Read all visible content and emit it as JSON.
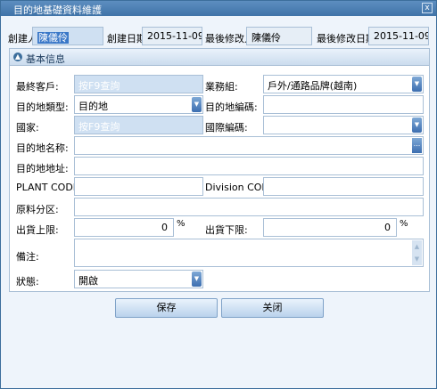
{
  "window": {
    "title": "目的地基礎資料維護",
    "close_glyph": "x"
  },
  "header": {
    "creator_label": "創建人:",
    "creator_value": "陳儀伶",
    "created_date_label": "創建日期:",
    "created_date_value": "2015-11-09",
    "modifier_label": "最後修改人:",
    "modifier_value": "陳儀伶",
    "modified_date_label": "最後修改日期:",
    "modified_date_value": "2015-11-09"
  },
  "section": {
    "title": "基本信息",
    "icon": "info-icon"
  },
  "form": {
    "final_customer_label": "最終客戶:",
    "final_customer_placeholder": "按F9查詢",
    "business_group_label": "業務組:",
    "business_group_value": "戶外/通路品牌(越南)",
    "dest_type_label": "目的地類型:",
    "dest_type_value": "目的地",
    "dest_code_label": "目的地編碼:",
    "dest_code_value": "",
    "country_label": "國家:",
    "country_placeholder": "按F9查詢",
    "intl_code_label": "國際編碼:",
    "intl_code_value": "",
    "dest_name_label": "目的地名称:",
    "dest_name_value": "",
    "dest_name_btn": "...",
    "dest_address_label": "目的地地址:",
    "dest_address_value": "",
    "plant_code_label": "PLANT CODE:",
    "plant_code_value": "",
    "division_code_label": "Division CODE:",
    "division_code_value": "",
    "material_zone_label": "原料分区:",
    "material_zone_value": "",
    "ship_upper_label": "出貨上限:",
    "ship_upper_value": "0",
    "ship_upper_unit": "%",
    "ship_lower_label": "出貨下限:",
    "ship_lower_value": "0",
    "ship_lower_unit": "%",
    "remark_label": "備注:",
    "remark_value": "",
    "status_label": "狀態:",
    "status_value": "開啟"
  },
  "footer": {
    "save_label": "保存",
    "close_label": "关闭"
  }
}
